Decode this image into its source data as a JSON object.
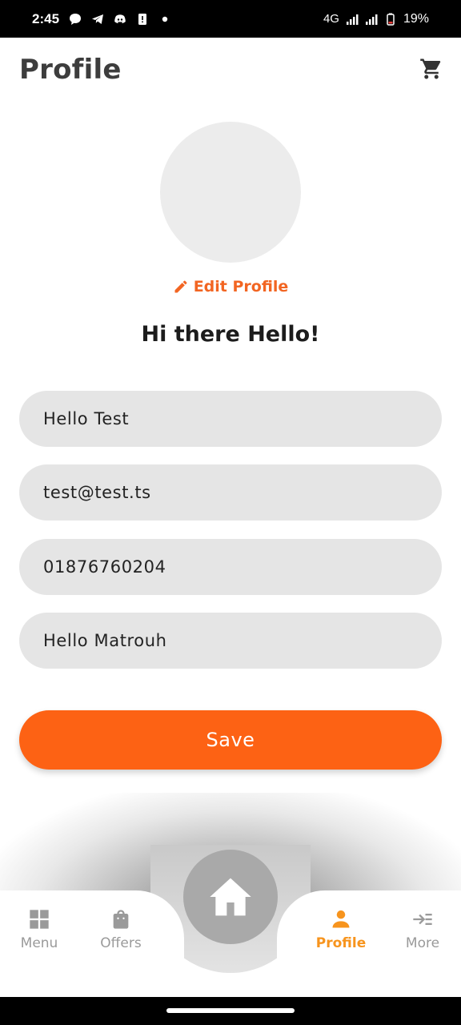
{
  "status_bar": {
    "time": "2:45",
    "network": "4G",
    "battery": "19%",
    "icons": [
      "chat-bubble-icon",
      "telegram-icon",
      "discord-icon",
      "alert-icon",
      "dot-icon",
      "signal-icon",
      "signal-icon",
      "battery-icon"
    ]
  },
  "header": {
    "title": "Profile",
    "cart_icon": "cart-icon"
  },
  "profile": {
    "edit_label": "Edit Profile",
    "greeting": "Hi there Hello!"
  },
  "form": {
    "name": "Hello Test",
    "email": "test@test.ts",
    "phone": "01876760204",
    "city": "Hello Matrouh",
    "save_label": "Save"
  },
  "bottom_nav": {
    "items": [
      {
        "label": "Menu",
        "icon": "grid-icon",
        "active": false
      },
      {
        "label": "Offers",
        "icon": "bag-icon",
        "active": false
      },
      {
        "label": "Profile",
        "icon": "person-icon",
        "active": true
      },
      {
        "label": "More",
        "icon": "more-icon",
        "active": false
      }
    ],
    "home_icon": "home-icon"
  },
  "colors": {
    "accent": "#fd6214",
    "edit_link": "#f26522",
    "nav_active": "#f7941d",
    "field_bg": "#e5e5e5",
    "avatar_bg": "#ececec"
  }
}
